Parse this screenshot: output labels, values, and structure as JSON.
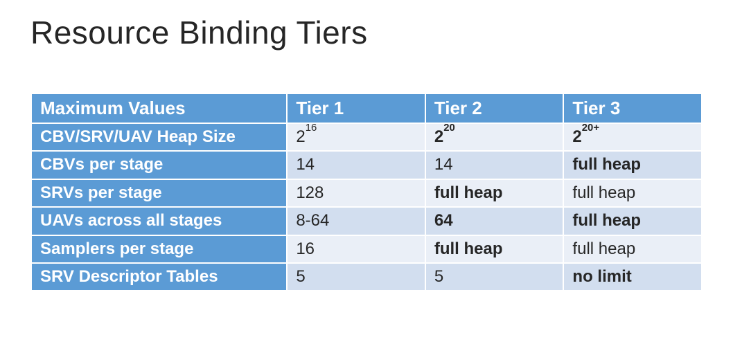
{
  "title": "Resource Binding Tiers",
  "headers": [
    "Maximum Values",
    "Tier 1",
    "Tier 2",
    "Tier 3"
  ],
  "rows": [
    {
      "label": "CBV/SRV/UAV Heap Size",
      "cells": [
        {
          "base": "2",
          "sup": "16",
          "bold": false
        },
        {
          "base": "2",
          "sup": "20",
          "bold": true
        },
        {
          "base": "2",
          "sup": "20+",
          "bold": true
        }
      ]
    },
    {
      "label": "CBVs per stage",
      "cells": [
        {
          "text": "14",
          "bold": false
        },
        {
          "text": "14",
          "bold": false
        },
        {
          "text": "full heap",
          "bold": true
        }
      ]
    },
    {
      "label": "SRVs per stage",
      "cells": [
        {
          "text": "128",
          "bold": false
        },
        {
          "text": "full heap",
          "bold": true
        },
        {
          "text": "full heap",
          "bold": false
        }
      ]
    },
    {
      "label": "UAVs across all stages",
      "cells": [
        {
          "text": "8-64",
          "bold": false
        },
        {
          "text": "64",
          "bold": true
        },
        {
          "text": "full heap",
          "bold": true
        }
      ]
    },
    {
      "label": "Samplers per stage",
      "cells": [
        {
          "text": "16",
          "bold": false
        },
        {
          "text": "full heap",
          "bold": true
        },
        {
          "text": "full heap",
          "bold": false
        }
      ]
    },
    {
      "label": "SRV Descriptor Tables",
      "cells": [
        {
          "text": "5",
          "bold": false
        },
        {
          "text": "5",
          "bold": false
        },
        {
          "text": "no limit",
          "bold": true
        }
      ]
    }
  ],
  "chart_data": {
    "type": "table",
    "title": "Resource Binding Tiers",
    "columns": [
      "Maximum Values",
      "Tier 1",
      "Tier 2",
      "Tier 3"
    ],
    "rows": [
      [
        "CBV/SRV/UAV Heap Size",
        "2^16",
        "2^20",
        "2^20+"
      ],
      [
        "CBVs per stage",
        "14",
        "14",
        "full heap"
      ],
      [
        "SRVs per stage",
        "128",
        "full heap",
        "full heap"
      ],
      [
        "UAVs across all stages",
        "8-64",
        "64",
        "full heap"
      ],
      [
        "Samplers per stage",
        "16",
        "full heap",
        "full heap"
      ],
      [
        "SRV Descriptor Tables",
        "5",
        "5",
        "no limit"
      ]
    ]
  }
}
